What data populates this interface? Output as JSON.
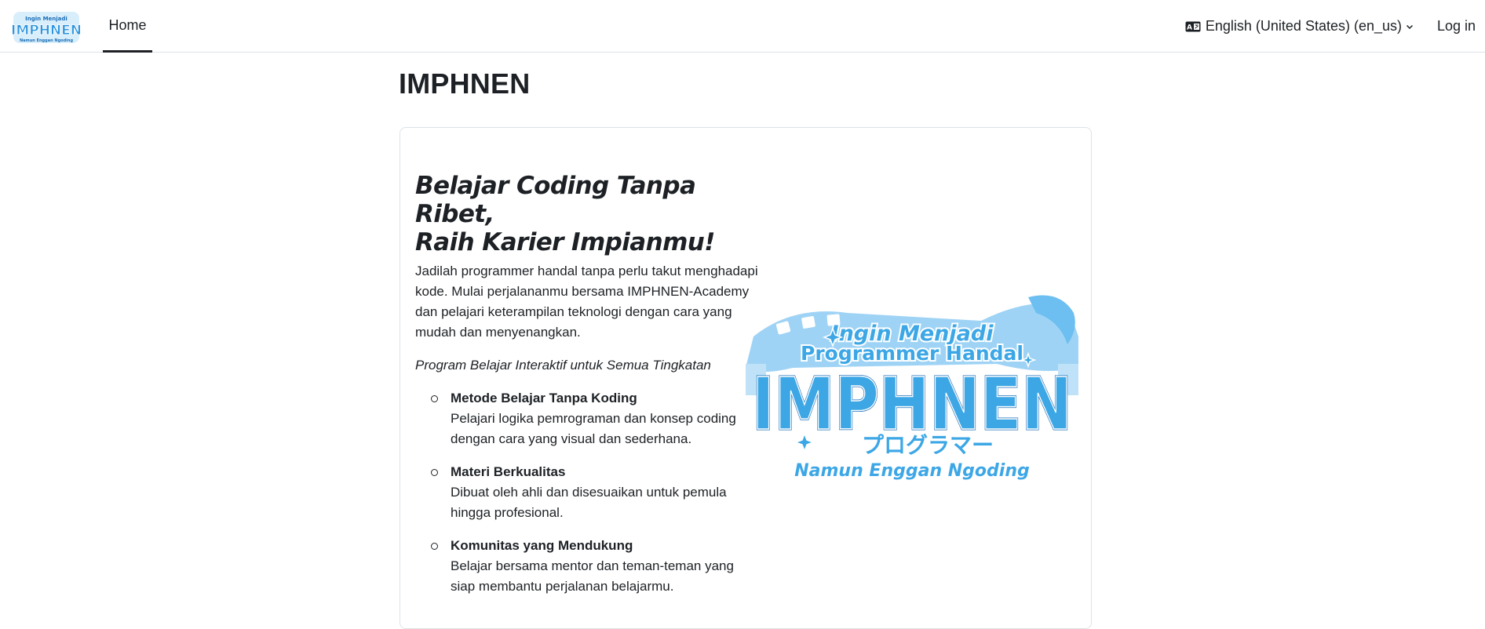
{
  "navbar": {
    "brand_name": "IMPHNEN",
    "home_label": "Home",
    "language_label": "English (United States) (en_us)",
    "login_label": "Log in",
    "icons": {
      "language": "language-icon",
      "dropdown": "chevron-down-icon"
    }
  },
  "page": {
    "title": "IMPHNEN"
  },
  "hero": {
    "headline_line1": "Belajar Coding Tanpa Ribet,",
    "headline_line2": "Raih Karier Impianmu!",
    "intro": "Jadilah programmer handal tanpa perlu takut menghadapi kode. Mulai perjalananmu bersama IMPHNEN-Academy dan pelajari keterampilan teknologi dengan cara yang mudah dan menyenangkan.",
    "tagline": "Program Belajar Interaktif untuk Semua Tingkatan",
    "features": [
      {
        "title": "Metode Belajar Tanpa Koding",
        "desc": "Pelajari logika pemrograman dan konsep coding dengan cara yang visual dan sederhana."
      },
      {
        "title": "Materi Berkualitas",
        "desc": "Dibuat oleh ahli dan disesuaikan untuk pemula hingga profesional."
      },
      {
        "title": "Komunitas yang Mendukung",
        "desc": "Belajar bersama mentor dan teman-teman yang siap membantu perjalanan belajarmu."
      }
    ]
  },
  "logo": {
    "line1": "Ingin Menjadi",
    "line2": "Programmer Handal",
    "main": "IMPHNEN",
    "katakana": "プログラマー",
    "line4": "Namun Enggan Ngoding"
  },
  "colors": {
    "text": "#1d2125",
    "border": "#dee2e6",
    "logo_blue": "#3da7e6",
    "logo_dark": "#1b6fb8"
  }
}
